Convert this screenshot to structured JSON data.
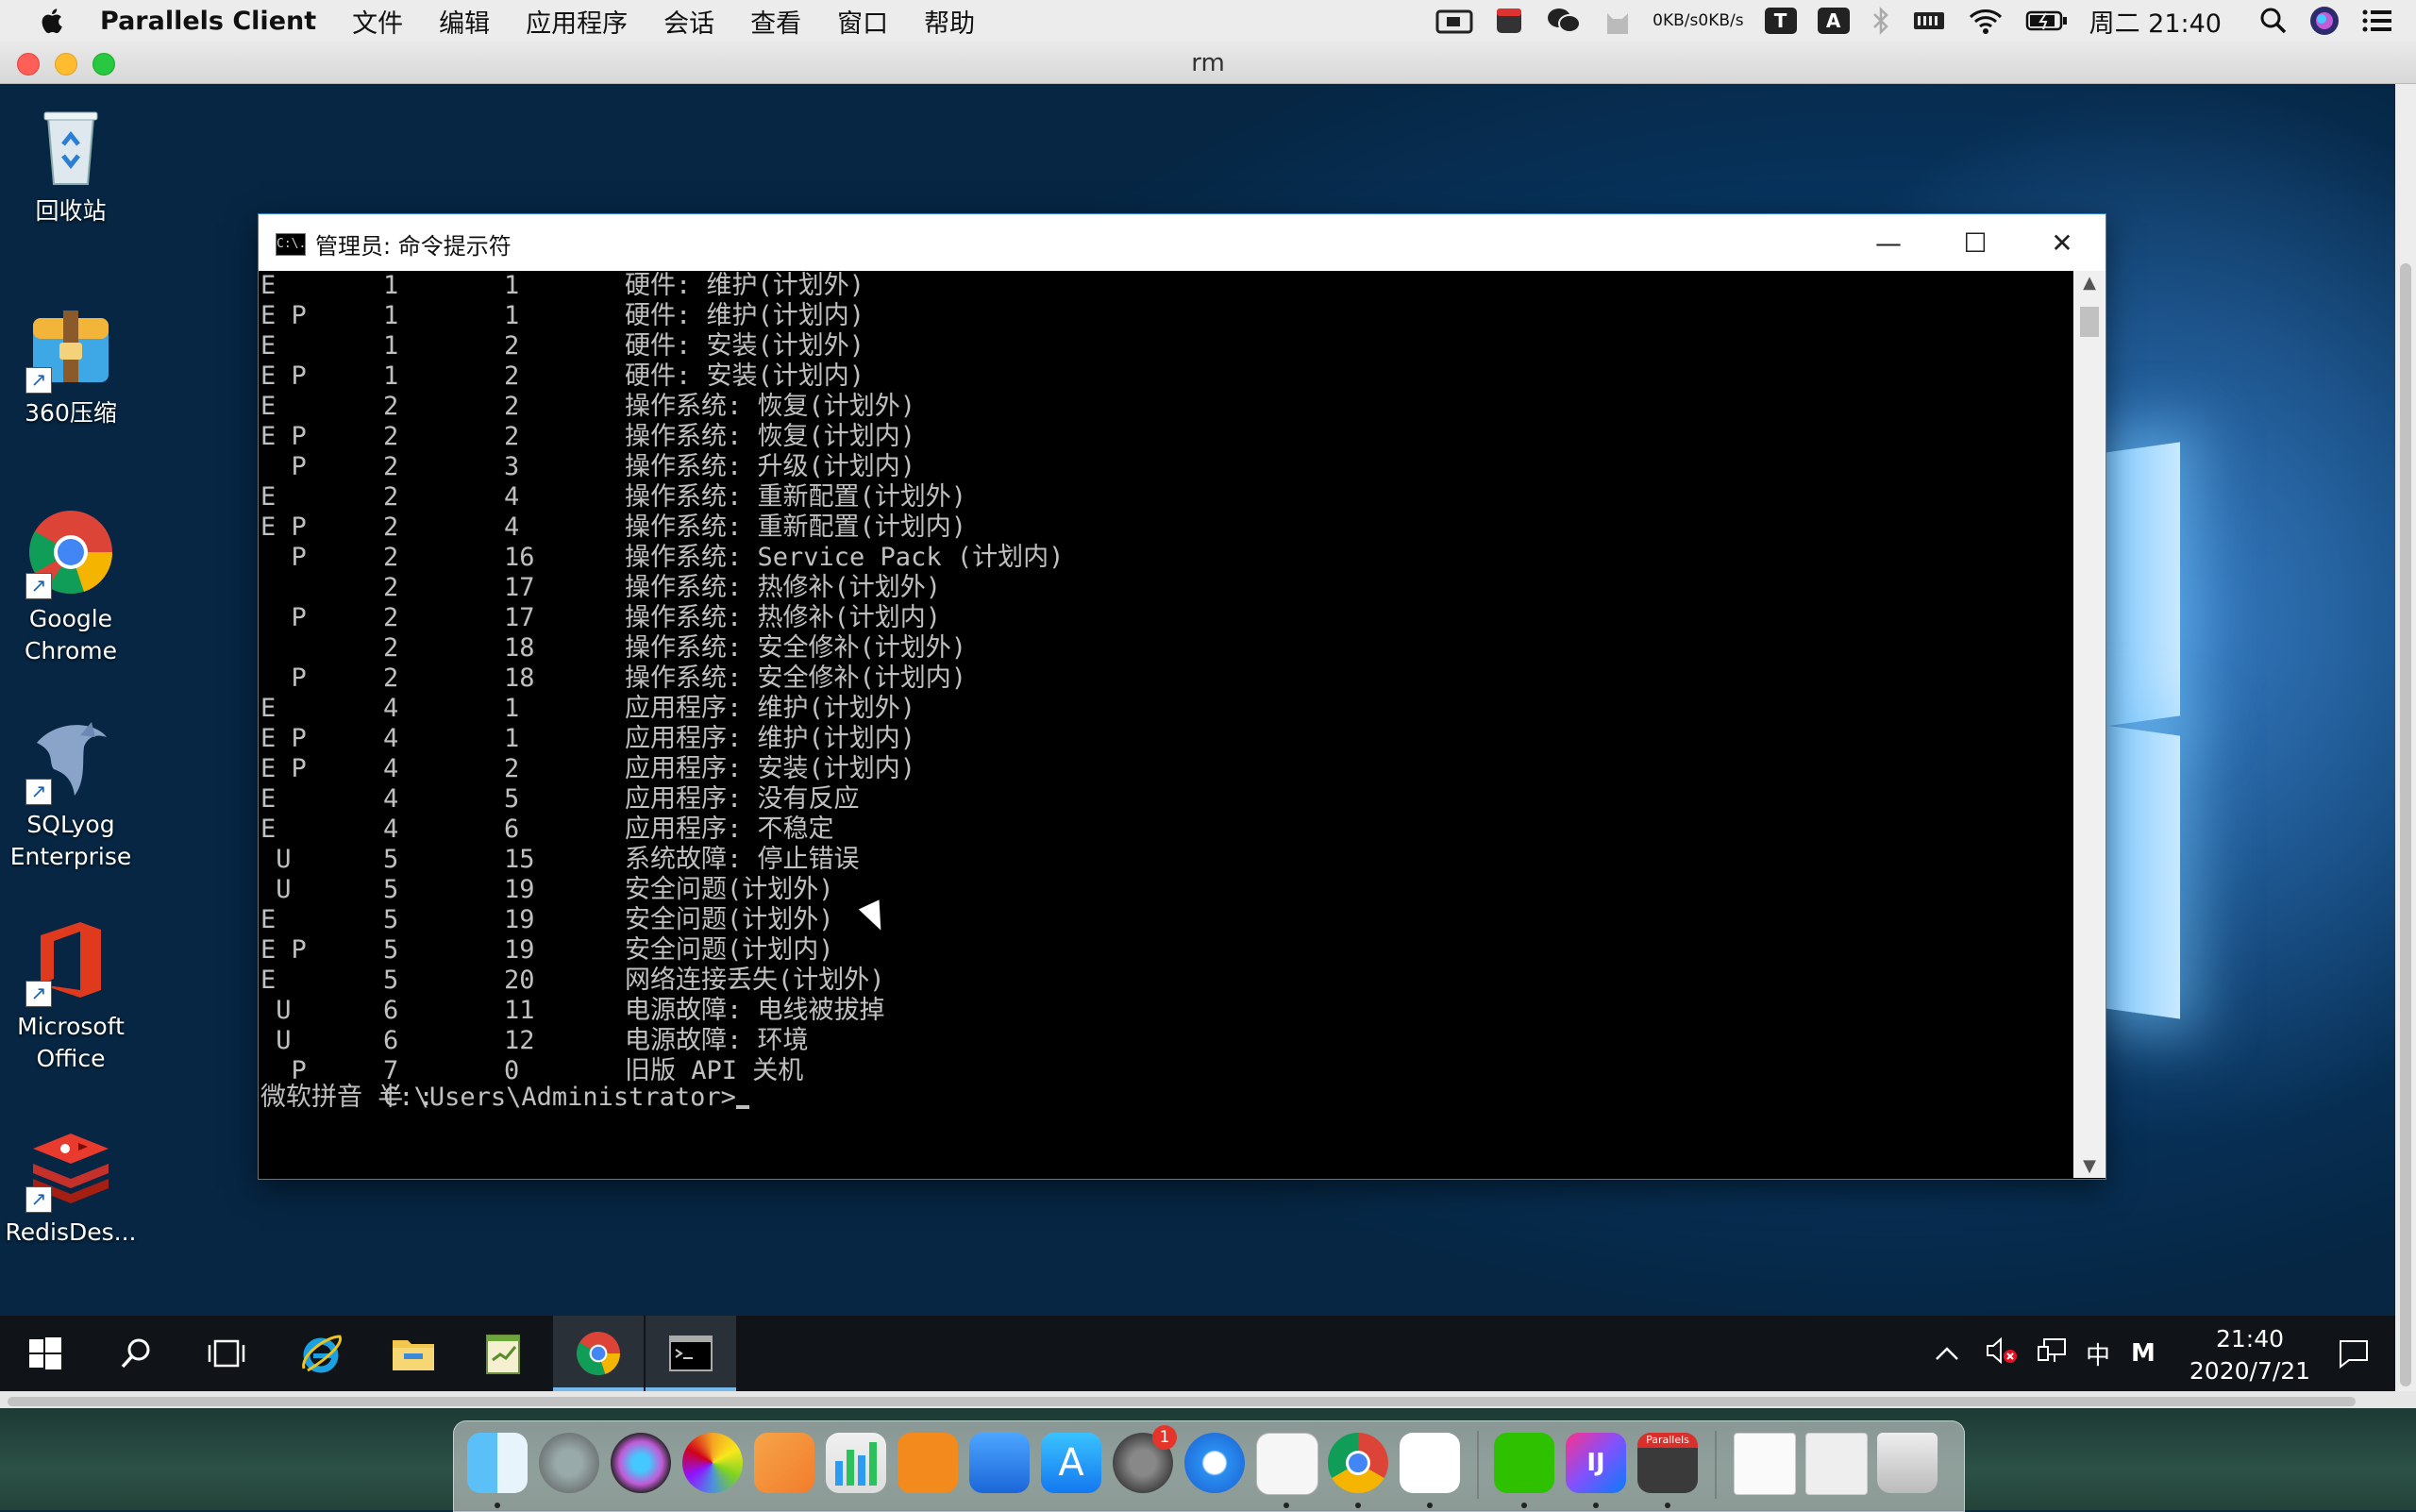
{
  "mac_menubar": {
    "app_name": "Parallels Client",
    "menus": [
      "文件",
      "编辑",
      "应用程序",
      "会话",
      "查看",
      "窗口",
      "帮助"
    ],
    "net_up": "0KB/s",
    "net_down": "0KB/s",
    "text_icon_t": "T",
    "text_icon_a": "A",
    "datetime": "周二 21:40"
  },
  "parallels_window": {
    "title": "rm"
  },
  "desktop_icons": [
    {
      "label": "回收站",
      "icon": "recycle-bin-icon"
    },
    {
      "label": "360压缩",
      "icon": "archive-icon"
    },
    {
      "label": "Google Chrome",
      "icon": "chrome-icon"
    },
    {
      "label": "SQLyog Enterprise",
      "icon": "dolphin-icon"
    },
    {
      "label": "Microsoft Office",
      "icon": "office-icon"
    },
    {
      "label": "RedisDes...",
      "icon": "redis-icon"
    }
  ],
  "cmd_window": {
    "title": "管理员: 命令提示符",
    "icon_text": "C:\\.",
    "minimize": "—",
    "maximize": "☐",
    "close": "✕",
    "rows": [
      {
        "flags": "E",
        "major": "1",
        "minor": "1",
        "reason": "硬件: 维护(计划外)"
      },
      {
        "flags": "E P",
        "major": "1",
        "minor": "1",
        "reason": "硬件: 维护(计划内)"
      },
      {
        "flags": "E",
        "major": "1",
        "minor": "2",
        "reason": "硬件: 安装(计划外)"
      },
      {
        "flags": "E P",
        "major": "1",
        "minor": "2",
        "reason": "硬件: 安装(计划内)"
      },
      {
        "flags": "E",
        "major": "2",
        "minor": "2",
        "reason": "操作系统: 恢复(计划外)"
      },
      {
        "flags": "E P",
        "major": "2",
        "minor": "2",
        "reason": "操作系统: 恢复(计划内)"
      },
      {
        "flags": "  P",
        "major": "2",
        "minor": "3",
        "reason": "操作系统: 升级(计划内)"
      },
      {
        "flags": "E",
        "major": "2",
        "minor": "4",
        "reason": "操作系统: 重新配置(计划外)"
      },
      {
        "flags": "E P",
        "major": "2",
        "minor": "4",
        "reason": "操作系统: 重新配置(计划内)"
      },
      {
        "flags": "  P",
        "major": "2",
        "minor": "16",
        "reason": "操作系统: Service Pack (计划内)"
      },
      {
        "flags": "",
        "major": "2",
        "minor": "17",
        "reason": "操作系统: 热修补(计划外)"
      },
      {
        "flags": "  P",
        "major": "2",
        "minor": "17",
        "reason": "操作系统: 热修补(计划内)"
      },
      {
        "flags": "",
        "major": "2",
        "minor": "18",
        "reason": "操作系统: 安全修补(计划外)"
      },
      {
        "flags": "  P",
        "major": "2",
        "minor": "18",
        "reason": "操作系统: 安全修补(计划内)"
      },
      {
        "flags": "E",
        "major": "4",
        "minor": "1",
        "reason": "应用程序: 维护(计划外)"
      },
      {
        "flags": "E P",
        "major": "4",
        "minor": "1",
        "reason": "应用程序: 维护(计划内)"
      },
      {
        "flags": "E P",
        "major": "4",
        "minor": "2",
        "reason": "应用程序: 安装(计划内)"
      },
      {
        "flags": "E",
        "major": "4",
        "minor": "5",
        "reason": "应用程序: 没有反应"
      },
      {
        "flags": "E",
        "major": "4",
        "minor": "6",
        "reason": "应用程序: 不稳定"
      },
      {
        "flags": " U",
        "major": "5",
        "minor": "15",
        "reason": "系统故障: 停止错误"
      },
      {
        "flags": " U",
        "major": "5",
        "minor": "19",
        "reason": "安全问题(计划外)"
      },
      {
        "flags": "E",
        "major": "5",
        "minor": "19",
        "reason": "安全问题(计划外)"
      },
      {
        "flags": "E P",
        "major": "5",
        "minor": "19",
        "reason": "安全问题(计划内)"
      },
      {
        "flags": "E",
        "major": "5",
        "minor": "20",
        "reason": "网络连接丢失(计划外)"
      },
      {
        "flags": " U",
        "major": "6",
        "minor": "11",
        "reason": "电源故障: 电线被拔掉"
      },
      {
        "flags": " U",
        "major": "6",
        "minor": "12",
        "reason": "电源故障: 环境"
      },
      {
        "flags": "  P",
        "major": "7",
        "minor": "0",
        "reason": "旧版 API 关机"
      }
    ],
    "prompt": "C:\\Users\\Administrator>",
    "ime_status": "微软拼音 半 :"
  },
  "taskbar": {
    "tray_lang": "中",
    "tray_ime": "M",
    "time": "21:40",
    "date": "2020/7/21"
  },
  "dock": {
    "badge_count": "1",
    "parallels_label": "Parallels"
  }
}
